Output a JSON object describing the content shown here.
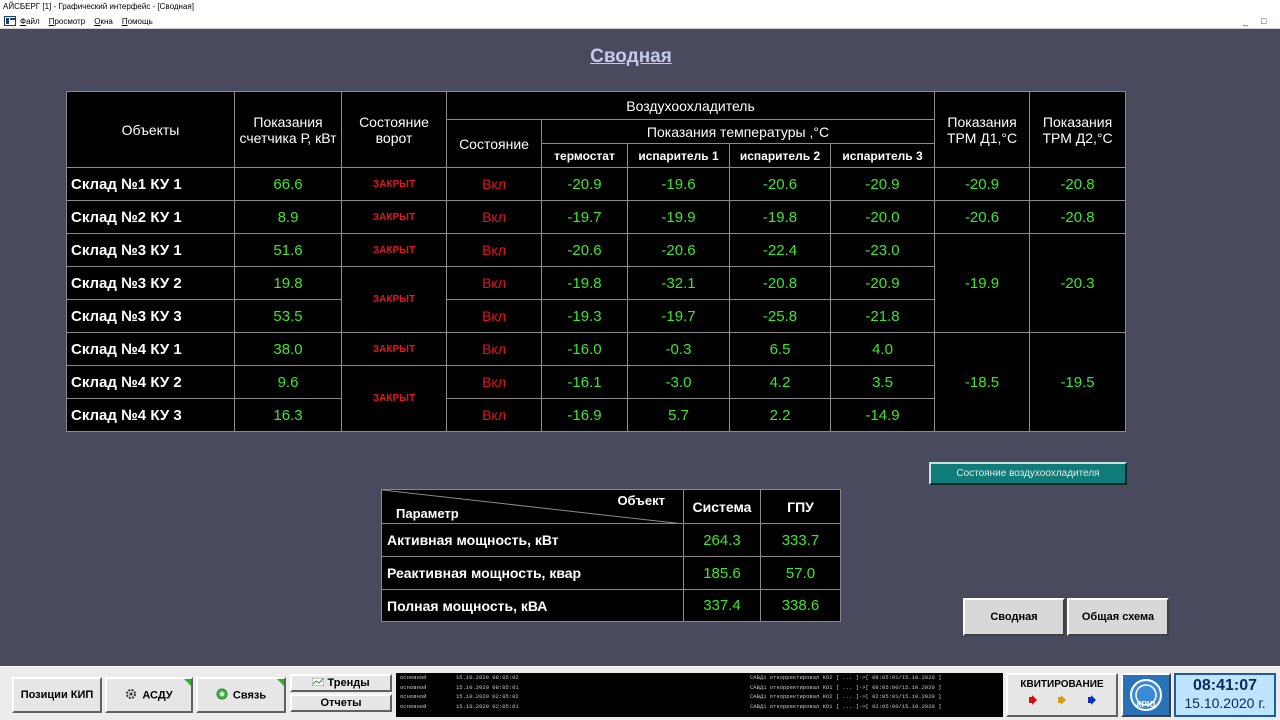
{
  "window": {
    "title": "АЙСБЕРГ [1] - Графический интерфейс - [Сводная]",
    "menu": [
      "Файл",
      "Просмотр",
      "Окна",
      "Помощь"
    ],
    "minimize": "_",
    "restore": "□"
  },
  "page": {
    "title": "Сводная"
  },
  "main_table": {
    "headers": {
      "objects": "Объекты",
      "meter": "Показания счетчика Р, кВт",
      "gate": "Состояние ворот",
      "cooler": "Воздухоохладитель",
      "state": "Состояние",
      "temp": "Показания температуры ,°С",
      "thermostat": "термостат",
      "evap1": "испаритель 1",
      "evap2": "испаритель 2",
      "evap3": "испаритель 3",
      "trm1": "Показания ТРМ Д1,°С",
      "trm2": "Показания ТРМ Д2,°С"
    },
    "rows": [
      {
        "name": "Склад №1 КУ 1",
        "meter": "66.6",
        "gate": "ЗАКРЫТ",
        "state": "Вкл",
        "thermostat": "-20.9",
        "evap1": "-19.6",
        "evap2": "-20.6",
        "evap3": "-20.9"
      },
      {
        "name": "Склад №2 КУ 1",
        "meter": "8.9",
        "gate": "ЗАКРЫТ",
        "state": "Вкл",
        "thermostat": "-19.7",
        "evap1": "-19.9",
        "evap2": "-19.8",
        "evap3": "-20.0"
      },
      {
        "name": "Склад №3 КУ 1",
        "meter": "51.6",
        "gate": "ЗАКРЫТ",
        "state": "Вкл",
        "thermostat": "-20.6",
        "evap1": "-20.6",
        "evap2": "-22.4",
        "evap3": "-23.0"
      },
      {
        "name": "Склад №3 КУ 2",
        "meter": "19.8",
        "state": "Вкл",
        "thermostat": "-19.8",
        "evap1": "-32.1",
        "evap2": "-20.8",
        "evap3": "-20.9"
      },
      {
        "name": "Склад №3 КУ 3",
        "meter": "53.5",
        "state": "Вкл",
        "thermostat": "-19.3",
        "evap1": "-19.7",
        "evap2": "-25.8",
        "evap3": "-21.8"
      },
      {
        "name": "Склад №4 КУ 1",
        "meter": "38.0",
        "gate": "ЗАКРЫТ",
        "state": "Вкл",
        "thermostat": "-16.0",
        "evap1": "-0.3",
        "evap2": "6.5",
        "evap3": "4.0"
      },
      {
        "name": "Склад №4 КУ 2",
        "meter": "9.6",
        "state": "Вкл",
        "thermostat": "-16.1",
        "evap1": "-3.0",
        "evap2": "4.2",
        "evap3": "3.5"
      },
      {
        "name": "Склад №4 КУ 3",
        "meter": "16.3",
        "state": "Вкл",
        "thermostat": "-16.9",
        "evap1": "5.7",
        "evap2": "2.2",
        "evap3": "-14.9"
      }
    ],
    "merged_gate": {
      "sklad3_ku23": "ЗАКРЫТ",
      "sklad4_ku23": "ЗАКРЫТ"
    },
    "trm": {
      "sklad1": {
        "d1": "-20.9",
        "d2": "-20.8"
      },
      "sklad2": {
        "d1": "-20.6",
        "d2": "-20.8"
      },
      "sklad3": {
        "d1": "-19.9",
        "d2": "-20.3"
      },
      "sklad4": {
        "d1": "-18.5",
        "d2": "-19.5"
      }
    }
  },
  "cooler_state_button": "Состояние воздухоохладителя",
  "power_table": {
    "header_object": "Объект",
    "header_param": "Параметр",
    "col_system": "Система",
    "col_gpu": "ГПУ",
    "rows": [
      {
        "label": "Активная мощность, кВт",
        "system": "264.3",
        "gpu": "333.7"
      },
      {
        "label": "Реактивная мощность, квар",
        "system": "185.6",
        "gpu": "57.0"
      },
      {
        "label": "Полная мощность, кВА",
        "system": "337.4",
        "gpu": "338.6"
      }
    ]
  },
  "nav_buttons": {
    "summary": "Сводная",
    "general": "Общая схема"
  },
  "bottom": {
    "kip": "Позиции КИП",
    "asdu": "АСДУ",
    "svyaz": "Связь",
    "trends": "Тренды",
    "reports": "Отчеты",
    "log": [
      {
        "src": "основной",
        "time": "15.10.2020 08:05:02",
        "msg": "САВД1 откорректировал КО2 [ ... ]->[ 08:05:01/15.10.2020 ]"
      },
      {
        "src": "основной",
        "time": "15.10.2020 08:05:01",
        "msg": "САВД1 откорректировал КО1 [ ... ]->[ 08:05:00/15.10.2020 ]"
      },
      {
        "src": "основной",
        "time": "15.10.2020 02:05:02",
        "msg": "САВД1 откорректировал КО2 [ ... ]->[ 02:05:01/15.10.2020 ]"
      },
      {
        "src": "основной",
        "time": "15.10.2020 02:05:01",
        "msg": "САВД1 откорректировал КО1 [ ... ]->[ 02:05:00/15.10.2020 ]"
      }
    ],
    "ack": "КВИТИРОВАНИЕ",
    "logo": "КРЮ",
    "time": "08:41:07",
    "date": "15.10.2020 г."
  },
  "colors": {
    "background": "#4a4a5e",
    "value_green": "#3ce82a",
    "alarm_red": "#e8141c",
    "teal_button": "#0f7c7a"
  }
}
